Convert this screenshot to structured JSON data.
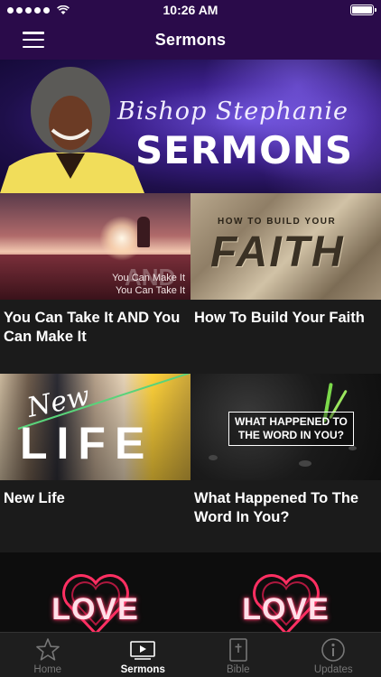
{
  "status_bar": {
    "time": "10:26 AM",
    "signal_dots": 5,
    "battery_level": 1.0
  },
  "nav": {
    "title": "Sermons",
    "menu_icon": "hamburger-menu-icon"
  },
  "hero": {
    "script_line": "Bishop Stephanie",
    "title": "SERMONS"
  },
  "tiles": [
    {
      "title": "You Can Take It AND You Can Make It",
      "image_text": [
        "You Can Make It",
        "You Can Take It",
        "AND"
      ]
    },
    {
      "title": "How To Build Your Faith",
      "image_text": [
        "HOW TO BUILD YOUR",
        "FAITH"
      ]
    },
    {
      "title": "New Life",
      "image_text": [
        "New",
        "LIFE"
      ]
    },
    {
      "title": "What Happened To The Word In You?",
      "image_text": [
        "WHAT HAPPENED TO",
        "THE WORD IN YOU?"
      ]
    }
  ],
  "love_tiles": [
    {
      "image_text": "LOVE"
    },
    {
      "image_text": "LOVE"
    }
  ],
  "tab_bar": {
    "tabs": [
      {
        "label": "Home",
        "icon": "star-icon"
      },
      {
        "label": "Sermons",
        "icon": "video-play-icon",
        "active": true
      },
      {
        "label": "Bible",
        "icon": "bible-icon"
      },
      {
        "label": "Updates",
        "icon": "info-icon"
      }
    ]
  },
  "colors": {
    "header_bg": "#2a0b4a",
    "background": "#1b1b1b",
    "tab_bar_bg": "#1e1e1e",
    "tab_inactive": "#777777",
    "tab_active": "#ffffff"
  }
}
